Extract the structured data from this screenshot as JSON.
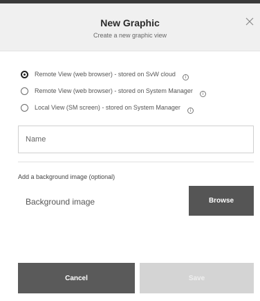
{
  "dialog": {
    "title": "New Graphic",
    "subtitle": "Create a new graphic view",
    "close_icon": "close-icon"
  },
  "view_options": [
    {
      "label": "Remote View (web browser) - stored on SvW cloud",
      "selected": true
    },
    {
      "label": "Remote View (web browser) - stored on System Manager",
      "selected": false
    },
    {
      "label": "Local View (SM screen) - stored on System Manager",
      "selected": false
    }
  ],
  "info_icon_glyph": "i",
  "name_field": {
    "value": "",
    "placeholder": "Name"
  },
  "background": {
    "section_label": "Add a background image (optional)",
    "field_label": "Background image",
    "browse_label": "Browse"
  },
  "footer": {
    "cancel_label": "Cancel",
    "save_label": "Save",
    "save_enabled": false
  },
  "colors": {
    "header_bg": "#f0f0f0",
    "primary_button": "#555555",
    "disabled_button": "#d4d4d4"
  }
}
